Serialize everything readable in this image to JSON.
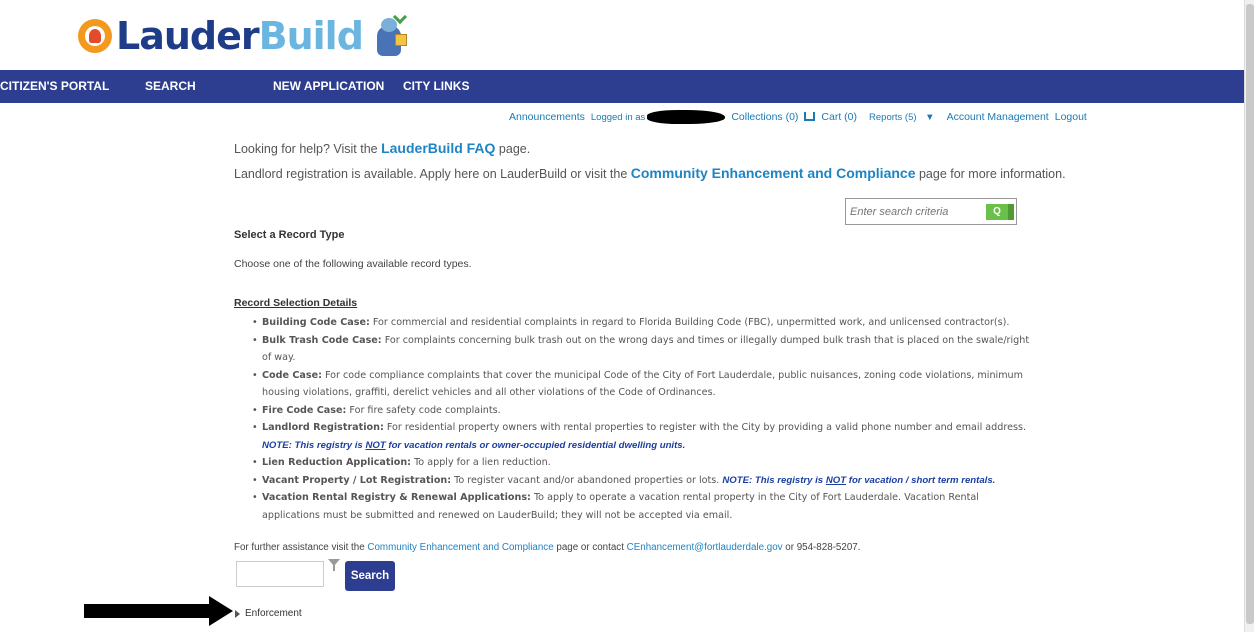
{
  "logo": {
    "part1": "Lauder",
    "part2": "Build"
  },
  "nav": {
    "items": [
      "CITIZEN'S PORTAL",
      "SEARCH",
      "NEW APPLICATION",
      "CITY LINKS"
    ]
  },
  "user_links": {
    "announcements": "Announcements",
    "logged_in": "Logged in as",
    "collections": "Collections (0)",
    "cart": "Cart (0)",
    "reports": "Reports (5)",
    "account": "Account Management",
    "logout": "Logout"
  },
  "help": {
    "line1_pre": "Looking for help? Visit the ",
    "line1_link": "LauderBuild FAQ",
    "line1_post": " page.",
    "line2_pre": "Landlord registration is available. Apply here on LauderBuild or visit the ",
    "line2_link": "Community Enhancement and Compliance",
    "line2_post": " page for more information."
  },
  "search": {
    "placeholder": "Enter search criteria",
    "button": "Q"
  },
  "record": {
    "heading": "Select a Record Type",
    "instruction": "Choose one of the following available record types.",
    "details_title": "Record Selection Details",
    "items": [
      {
        "term": "Building Code Case:",
        "text": " For commercial and residential complaints in regard to Florida Building Code (FBC), unpermitted work, and unlicensed contractor(s)."
      },
      {
        "term": "Bulk Trash Code Case:",
        "text": " For complaints concerning bulk trash out on the wrong days and times or illegally dumped bulk trash that is placed on the swale/right of way."
      },
      {
        "term": "Code Case:",
        "text": " For code compliance complaints that cover the municipal Code of the City of Fort Lauderdale, public nuisances, zoning code violations, minimum housing violations, graffiti, derelict vehicles and all other violations of the Code of Ordinances."
      },
      {
        "term": "Fire Code Case:",
        "text": " For fire safety code complaints."
      },
      {
        "term": "Landlord Registration:",
        "text": "  For residential property owners with rental properties to register with the City by providing a valid phone number and email address. ",
        "note_pre": "NOTE: This registry is ",
        "note_u": "NOT",
        "note_post": " for vacation rentals or owner-occupied residential dwelling units."
      },
      {
        "term": "Lien Reduction Application:",
        "text": "  To apply for a lien reduction."
      },
      {
        "term": "Vacant Property / Lot Registration:",
        "text": "  To register vacant and/or abandoned properties or lots. ",
        "note_pre": "NOTE: This registry is ",
        "note_u": "NOT",
        "note_post": " for vacation / short term rentals."
      },
      {
        "term": "Vacation Rental Registry & Renewal Applications:",
        "text": "  To apply to operate a vacation rental property in the City of Fort Lauderdale. Vacation Rental applications must be submitted and renewed on LauderBuild; they will not be accepted via email."
      }
    ]
  },
  "assist": {
    "pre": "For further assistance visit the ",
    "link1": "Community Enhancement and Compliance",
    "mid": " page or contact ",
    "link2": "CEnhancement@fortlauderdale.gov",
    "post": " or 954-828-5207."
  },
  "bottom": {
    "search_button": "Search",
    "enforcement": "Enforcement"
  }
}
